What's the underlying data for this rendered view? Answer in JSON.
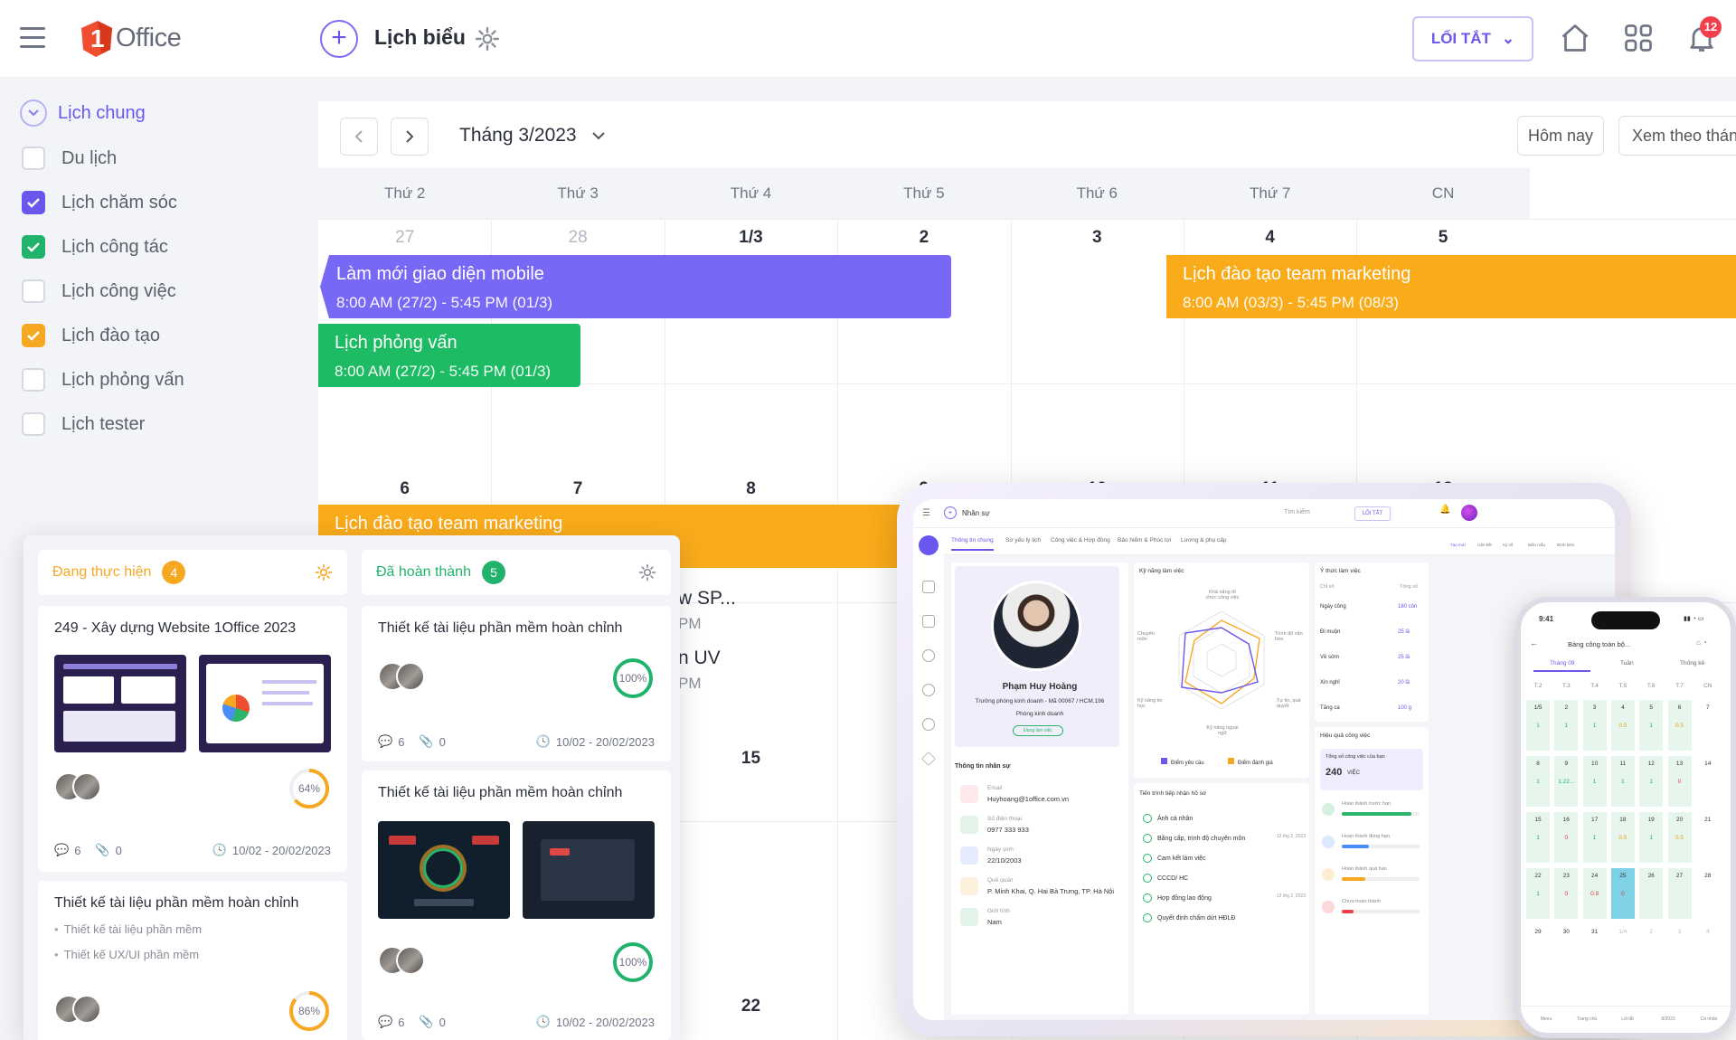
{
  "header": {
    "logo_text": "Office",
    "logo_digit": "1",
    "title": "Lịch biểu",
    "shortcut_label": "LỐI TẮT",
    "notification_count": "12"
  },
  "sidebar": {
    "group_label": "Lịch chung",
    "items": [
      {
        "label": "Du lịch",
        "checked": false,
        "color": ""
      },
      {
        "label": "Lịch chăm sóc",
        "checked": true,
        "color": "#6a57ee"
      },
      {
        "label": "Lịch công tác",
        "checked": true,
        "color": "#21b36b"
      },
      {
        "label": "Lịch công việc",
        "checked": false,
        "color": ""
      },
      {
        "label": "Lịch đào tạo",
        "checked": true,
        "color": "#f7a823"
      },
      {
        "label": "Lịch phỏng vấn",
        "checked": false,
        "color": ""
      },
      {
        "label": "Lịch tester",
        "checked": false,
        "color": ""
      }
    ]
  },
  "calendar": {
    "month_label": "Tháng 3/2023",
    "today_label": "Hôm nay",
    "view_label": "Xem theo tháng",
    "weekdays": [
      "Thứ 2",
      "Thứ 3",
      "Thứ 4",
      "Thứ 5",
      "Thứ 6",
      "Thứ 7",
      "CN"
    ],
    "week1_days": [
      "27",
      "28",
      "1/3",
      "2",
      "3",
      "4",
      "5"
    ],
    "week2_days": [
      "6",
      "7",
      "8",
      "9",
      "10",
      "11",
      "12"
    ],
    "week3_days": [
      "15"
    ],
    "week4_days": [
      "22"
    ],
    "events": [
      {
        "title": "Làm mới giao diện mobile",
        "time": "8:00 AM (27/2) - 5:45 PM (01/3)",
        "color": "#7868f6"
      },
      {
        "title": "Lịch phỏng vấn",
        "time": "8:00 AM (27/2) - 5:45 PM (01/3)",
        "color": "#1dbb63"
      },
      {
        "title": "Lịch đào tạo team marketing",
        "time": "8:00 AM (03/3) - 5:45 PM (08/3)",
        "color": "#f9ab1a"
      },
      {
        "title": "Lịch đào tạo team marketing",
        "time": "",
        "color": "#f9ab1a"
      }
    ],
    "partial_texts": [
      "w SP...",
      "PM",
      "n UV",
      "PM"
    ]
  },
  "kanban": {
    "columns": [
      {
        "label": "Đang thực hiện",
        "count": "4",
        "color": "#f7a823"
      },
      {
        "label": "Đã hoàn thành",
        "count": "5",
        "color": "#21b36b"
      }
    ],
    "cards": [
      {
        "title": "249 - Xây dựng Website 1Office 2023",
        "progress": "64%",
        "comments": "6",
        "attachments": "0",
        "dates": "10/02 - 20/02/2023"
      },
      {
        "title": "Thiết kế tài liệu phần mềm hoàn chỉnh",
        "subtasks": [
          "Thiết kế tài liệu phần mềm",
          "Thiết kế UX/UI phần mềm"
        ],
        "progress": "86%"
      },
      {
        "title": "Thiết kế tài liệu phần mềm hoàn chỉnh",
        "progress": "100%",
        "comments": "6",
        "attachments": "0",
        "dates": "10/02 - 20/02/2023"
      },
      {
        "title": "Thiết kế tài liệu phần mềm hoàn chỉnh",
        "progress": "100%",
        "comments": "6",
        "attachments": "0",
        "dates": "10/02 - 20/02/2023"
      }
    ]
  },
  "tablet": {
    "breadcrumb": "Nhân sự",
    "search": "Tìm kiếm",
    "shortcut": "LỐI TẮT",
    "tabs": [
      "Thông tin chung",
      "Sơ yếu lý lịch",
      "Công việc & Hợp đồng",
      "Bảo hiểm & Phúc lợi",
      "Lương & phụ cấp"
    ],
    "toolbar": [
      "Tạo mới",
      "Liên kết",
      "Ký số",
      "Biểu mẫu",
      "Đính kèm"
    ],
    "profile": {
      "name": "Phạm Huy Hoàng",
      "role": "Trưởng phòng kinh doanh - Mã 00067 / HCM.196",
      "dept": "Phòng kinh doanh",
      "status": "Đang làm việc"
    },
    "info_title": "Thông tin nhân sự",
    "info": [
      {
        "k": "Email",
        "v": "Huyhoang@1office.com.vn"
      },
      {
        "k": "Số điện thoại",
        "v": "0977 333 933"
      },
      {
        "k": "Ngày sinh",
        "v": "22/10/2003"
      },
      {
        "k": "Quê quán",
        "v": "P. Minh Khai, Q. Hai Bà Trưng, TP. Hà Nội"
      },
      {
        "k": "Giới tính",
        "v": "Nam"
      }
    ],
    "skills_title": "Kỹ năng làm việc",
    "radar_labels": [
      "Khả năng tổ chức công việc",
      "Trình độ văn hóa",
      "Tự tin, quả quyết",
      "Kỹ năng ngoại ngữ",
      "Kỹ năng tin học",
      "Chuyên môn"
    ],
    "legend": [
      "Điểm yêu cầu",
      "Điểm đánh giá"
    ],
    "progress_title": "Tiến trình tiếp nhận hồ sơ",
    "checklist": [
      {
        "t": "Ảnh cá nhân",
        "d": ""
      },
      {
        "t": "Bằng cấp, trình độ chuyên môn",
        "d": "12 thg 2, 2023"
      },
      {
        "t": "Cam kết làm việc",
        "d": ""
      },
      {
        "t": "CCCD/ HC",
        "d": ""
      },
      {
        "t": "Hợp đồng lao động",
        "d": "12 thg 2, 2023"
      },
      {
        "t": "Quyết định chấm dứt HĐLĐ",
        "d": ""
      }
    ],
    "attendance_title": "Ý thức làm việc",
    "attendance_cols": [
      "Chỉ số",
      "Tổng số"
    ],
    "attendance": [
      {
        "k": "Ngày công",
        "v": "180 côn"
      },
      {
        "k": "Đi muộn",
        "v": "25 lầ"
      },
      {
        "k": "Về sớm",
        "v": "25 lầ"
      },
      {
        "k": "Xin nghỉ",
        "v": "20 lầ"
      },
      {
        "k": "Tăng ca",
        "v": "100 g"
      }
    ],
    "perf_title": "Hiệu quả công việc",
    "perf_total_label": "Tổng số công việc của bạn",
    "perf_total": "240",
    "perf_unit": "VIỆC",
    "perf_items": [
      "Hoàn thành trước hạn",
      "Hoàn thành đúng hạn",
      "Hoàn thành quá hạn",
      "Chưa hoàn thành"
    ]
  },
  "phone": {
    "time": "9:41",
    "title": "Bảng công toàn bộ...",
    "tabs": [
      "Tháng 09",
      "Tuần",
      "Thống kê"
    ],
    "weekdays": [
      "T.2",
      "T.3",
      "T.4",
      "T.5",
      "T.6",
      "T.7",
      "CN"
    ],
    "rows": [
      {
        "days": [
          "1/5",
          "2",
          "3",
          "4",
          "5",
          "6",
          "7"
        ],
        "vals": [
          "1",
          "1",
          "1",
          "0.5",
          "1",
          "0.5",
          ""
        ]
      },
      {
        "days": [
          "8",
          "9",
          "10",
          "11",
          "12",
          "13",
          "14"
        ],
        "vals": [
          "1",
          "1.22...",
          "1",
          "1",
          "1",
          "0",
          ""
        ]
      },
      {
        "days": [
          "15",
          "16",
          "17",
          "18",
          "19",
          "20",
          "21"
        ],
        "vals": [
          "1",
          "0",
          "1",
          "0.5",
          "1",
          "0.5",
          ""
        ]
      },
      {
        "days": [
          "22",
          "23",
          "24",
          "25",
          "26",
          "27",
          "28"
        ],
        "vals": [
          "1",
          "0",
          "0.9",
          "0",
          "",
          "",
          ""
        ]
      },
      {
        "days": [
          "29",
          "30",
          "31",
          "1/4",
          "2",
          "3",
          "4"
        ],
        "vals": [
          "",
          "",
          "",
          "",
          "",
          "",
          ""
        ]
      }
    ],
    "nav": [
      "Menu",
      "Trang chủ",
      "Lối tắt",
      "8/2023",
      "Cá nhân"
    ]
  },
  "colors": {
    "primary": "#6a57ee",
    "green": "#21b36b",
    "orange": "#f7a823",
    "red": "#f33e4c"
  }
}
